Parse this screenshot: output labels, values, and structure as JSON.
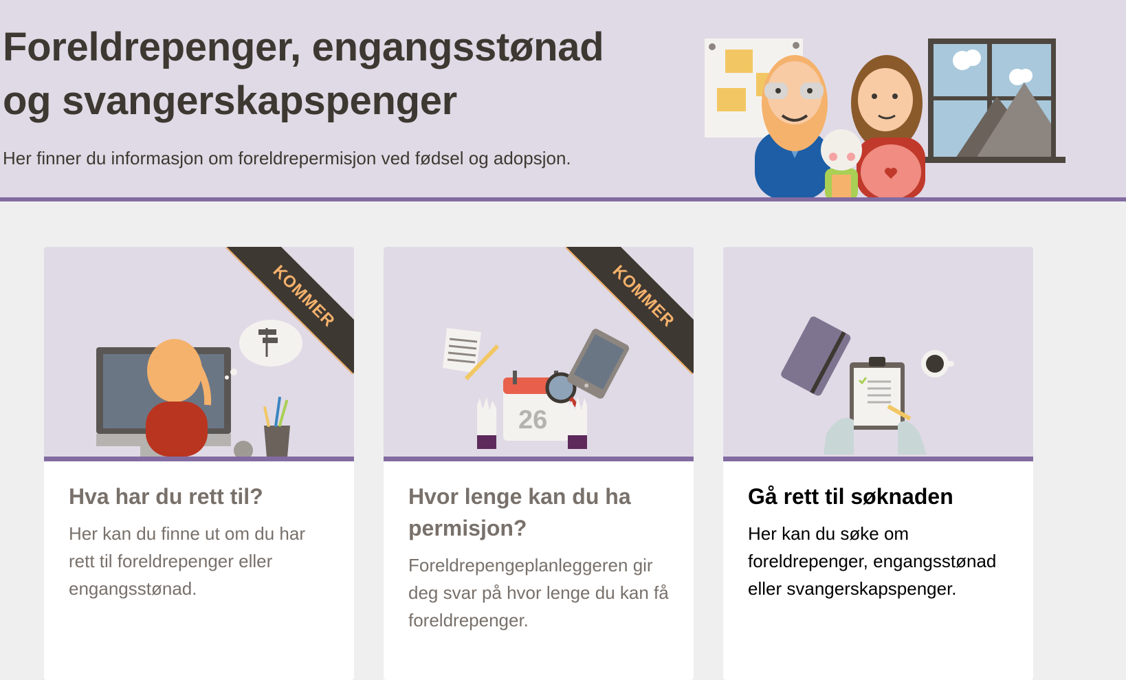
{
  "hero": {
    "title": "Foreldrepenger, engangsstønad og svangerskapspenger",
    "subtitle": "Her finner du informasjon om foreldrepermisjon ved fødsel og adopsjon.",
    "illustration_icon": "family-illustration"
  },
  "cards": [
    {
      "title": "Hva har du rett til?",
      "text": "Her kan du finne ut om du har rett til foreldrepenger eller engangsstønad.",
      "badge": "KOMMER",
      "badge_icon": "construction-helmet-icon",
      "illustration_icon": "person-at-computer-illustration"
    },
    {
      "title": "Hvor lenge kan du ha permisjon?",
      "text": "Foreldrepengeplanleggeren gir deg svar på hvor lenge du kan få foreldrepenger.",
      "badge": "KOMMER",
      "badge_icon": "construction-helmet-icon",
      "calendar_day": "26",
      "illustration_icon": "calendar-planning-illustration"
    },
    {
      "title": "Gå rett til søknaden",
      "text": "Her kan du søke om foreldrepenger, engangsstønad eller svangerskapspenger.",
      "illustration_icon": "clipboard-application-illustration"
    }
  ],
  "colors": {
    "accent": "#826ba1",
    "hero_bg": "#e0dae6",
    "page_bg": "#efefef",
    "ribbon_bg": "#3e3832",
    "ribbon_text": "#f5b26c",
    "heading_text": "#3e3832",
    "muted_text": "#78706a"
  }
}
